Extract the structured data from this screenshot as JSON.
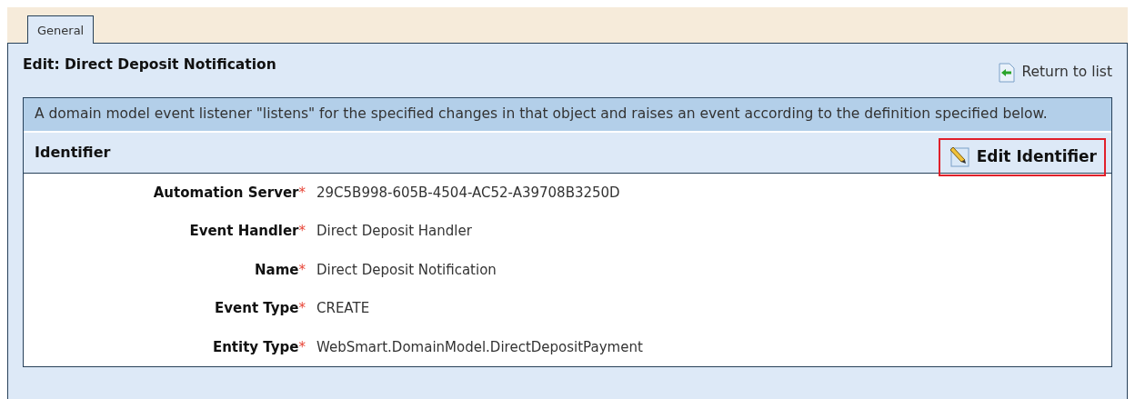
{
  "tabs": [
    {
      "label": "General",
      "selected": true
    }
  ],
  "header": {
    "title": "Edit: Direct Deposit Notification",
    "return_link": "Return to list"
  },
  "description": "A domain model event listener \"listens\" for the specified changes in that object and raises an event according to the definition specified below.",
  "section": {
    "title": "Identifier",
    "edit_button": {
      "label": "Edit Identifier",
      "highlighted": true
    }
  },
  "fields": [
    {
      "label": "Automation Server",
      "required_mark": "*",
      "value": "29C5B998-605B-4504-AC52-A39708B3250D"
    },
    {
      "label": "Event Handler",
      "required_mark": "*",
      "value": "Direct Deposit Handler"
    },
    {
      "label": "Name",
      "required_mark": "*",
      "value": "Direct Deposit Notification"
    },
    {
      "label": "Event Type",
      "required_mark": "*",
      "value": "CREATE"
    },
    {
      "label": "Entity Type",
      "required_mark": "*",
      "value": "WebSmart.DomainModel.DirectDepositPayment"
    }
  ]
}
